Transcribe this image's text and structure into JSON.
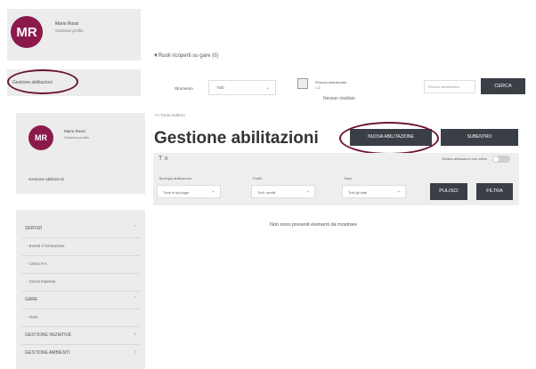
{
  "user": {
    "initials": "MR",
    "name": "Mario Rossi",
    "profile_link": "Gestione profilo"
  },
  "top_view": {
    "menu_item": "Gestione abilitazioni",
    "filter_link": "▼Ruoli ricoperti su gare (0)",
    "strumento_label": "Strumento",
    "strumento_value": "Tutti",
    "period_label": "Periodo selezionato",
    "period_value": "1-3",
    "no_results": "Nessun risultato",
    "search_placeholder": "Ricerca identificativo",
    "cerca_label": "CERCA"
  },
  "sidebar": {
    "current_item": "Gestione abilitazioni",
    "nav": [
      {
        "label": "SERVIZI",
        "type": "section",
        "arrow": "^"
      },
      {
        "label": "- Eventi e formazione",
        "type": "sub"
      },
      {
        "label": "- Cerca P.A.",
        "type": "sub"
      },
      {
        "label": "- Cerca Impresa",
        "type": "sub"
      },
      {
        "label": "GARE",
        "type": "section",
        "arrow": "^"
      },
      {
        "label": "- Gare",
        "type": "sub"
      },
      {
        "label": "GESTIONE INIZIATIVE",
        "type": "section",
        "arrow": "v"
      },
      {
        "label": "GESTIONE AMBIENTI",
        "type": "section",
        "arrow": "v"
      }
    ]
  },
  "main": {
    "back_link": "<< Torna indietro",
    "title": "Gestione abilitazioni",
    "new_button": "NUOVA ABILITAZIONE",
    "subentro_button": "SUBENTRO",
    "filters": {
      "toggle_icon": "T ∧",
      "toggle_label": "Mostra abilitazioni non attive",
      "tipologia_label": "Tipologia abilitazione",
      "tipologia_value": "Tutte le tipologie",
      "profili_label": "Profili",
      "profili_value": "Tutti i profili",
      "stato_label": "Stato",
      "stato_value": "Tutti gli stati",
      "pulisci_label": "PULISCI",
      "filtra_label": "FILTRA"
    },
    "empty_message": "Non sono presenti elementi da mostrare"
  },
  "colors": {
    "avatar": "#8b1a4a",
    "button": "#3a3f46",
    "highlight_circle": "#6b1434",
    "panel": "#eeeeee"
  }
}
